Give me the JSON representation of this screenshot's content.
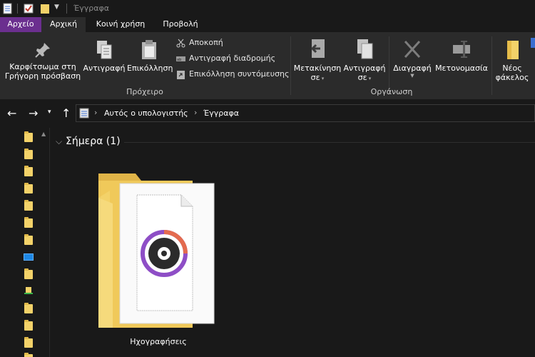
{
  "window": {
    "title": "Έγγραφα"
  },
  "ribbon_tabs": [
    {
      "label": "Αρχείο"
    },
    {
      "label": "Αρχική"
    },
    {
      "label": "Κοινή χρήση"
    },
    {
      "label": "Προβολή"
    }
  ],
  "ribbon": {
    "pin_label_1": "Καρφίτσωμα στη",
    "pin_label_2": "Γρήγορη πρόσβαση",
    "copy_label": "Αντιγραφή",
    "paste_label": "Επικόλληση",
    "cut_label": "Αποκοπή",
    "copy_path_label": "Αντιγραφή διαδρομής",
    "paste_shortcut_label": "Επικόλληση συντόμευσης",
    "clipboard_group": "Πρόχειρο",
    "move_to_label_1": "Μετακίνηση",
    "move_to_label_2": "σε",
    "copy_to_label_1": "Αντιγραφή",
    "copy_to_label_2": "σε",
    "delete_label": "Διαγραφή",
    "rename_label": "Μετονομασία",
    "organize_group": "Οργάνωση",
    "new_folder_label_1": "Νέος",
    "new_folder_label_2": "φάκελος"
  },
  "address": {
    "crumbs": [
      "Αυτός ο υπολογιστής",
      "Έγγραφα"
    ]
  },
  "content": {
    "group_title": "Σήμερα (1)",
    "items": [
      {
        "name": "Ηχογραφήσεις",
        "icon": "recordings-folder-icon"
      }
    ]
  },
  "colors": {
    "file_tab": "#6b2f8f",
    "ribbon_bg": "#2b2b2b",
    "folder": "#f3d269"
  }
}
